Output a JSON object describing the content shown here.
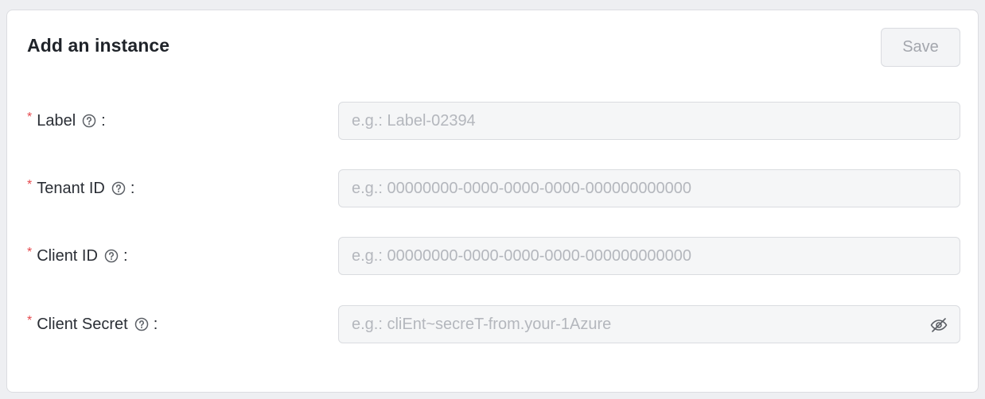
{
  "form": {
    "title": "Add an instance",
    "save_label": "Save",
    "required_mark": "*",
    "colon": ":",
    "fields": [
      {
        "label": "Label",
        "placeholder": "e.g.: Label-02394",
        "value": ""
      },
      {
        "label": "Tenant ID",
        "placeholder": "e.g.: 00000000-0000-0000-0000-000000000000",
        "value": ""
      },
      {
        "label": "Client ID",
        "placeholder": "e.g.: 00000000-0000-0000-0000-000000000000",
        "value": ""
      },
      {
        "label": "Client Secret",
        "placeholder": "e.g.: cliEnt~secreT-from.your-1Azure",
        "value": ""
      }
    ]
  },
  "icons": {
    "help": "question-circle-icon",
    "secret_toggle": "eye-slash-icon"
  },
  "colors": {
    "required": "#e5484d",
    "text": "#2a2e35",
    "placeholder": "#b4b7bd",
    "input_bg": "#f5f6f7",
    "page_bg": "#eeeff2"
  }
}
